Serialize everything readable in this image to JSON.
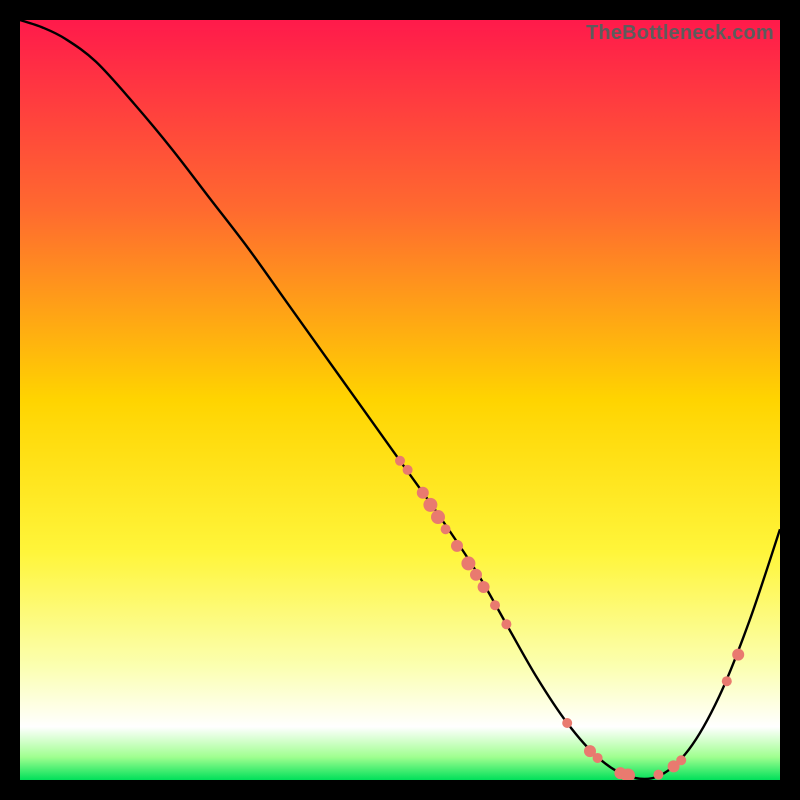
{
  "watermark": "TheBottleneck.com",
  "chart_data": {
    "type": "line",
    "title": "",
    "xlabel": "",
    "ylabel": "",
    "xlim": [
      0,
      100
    ],
    "ylim": [
      0,
      100
    ],
    "background_gradient_stops": [
      {
        "offset": 0.0,
        "color": "#ff1a4b"
      },
      {
        "offset": 0.25,
        "color": "#ff6a2f"
      },
      {
        "offset": 0.5,
        "color": "#ffd400"
      },
      {
        "offset": 0.7,
        "color": "#fff53a"
      },
      {
        "offset": 0.85,
        "color": "#fbffb0"
      },
      {
        "offset": 0.93,
        "color": "#ffffff"
      },
      {
        "offset": 0.97,
        "color": "#9fff8f"
      },
      {
        "offset": 1.0,
        "color": "#00e05a"
      }
    ],
    "series": [
      {
        "name": "bottleneck-curve",
        "x": [
          0,
          3,
          6,
          10,
          15,
          20,
          25,
          30,
          35,
          40,
          45,
          50,
          55,
          60,
          64,
          68,
          72,
          76,
          80,
          84,
          88,
          92,
          96,
          100
        ],
        "y": [
          100,
          99,
          97.5,
          94.5,
          89,
          83,
          76.5,
          70,
          63,
          56,
          49,
          42,
          35,
          27.5,
          20.5,
          13.5,
          7.5,
          3,
          0.5,
          0.5,
          4,
          11,
          21,
          33
        ]
      }
    ],
    "markers": [
      {
        "name": "pt-a",
        "x": 50,
        "y": 42,
        "r": 5
      },
      {
        "name": "pt-b",
        "x": 51,
        "y": 40.8,
        "r": 5
      },
      {
        "name": "pt-c",
        "x": 53,
        "y": 37.8,
        "r": 6
      },
      {
        "name": "pt-d",
        "x": 54,
        "y": 36.2,
        "r": 7
      },
      {
        "name": "pt-e",
        "x": 55,
        "y": 34.6,
        "r": 7
      },
      {
        "name": "pt-f",
        "x": 56,
        "y": 33.0,
        "r": 5
      },
      {
        "name": "pt-g",
        "x": 57.5,
        "y": 30.8,
        "r": 6
      },
      {
        "name": "pt-h",
        "x": 59,
        "y": 28.5,
        "r": 7
      },
      {
        "name": "pt-i",
        "x": 60,
        "y": 27.0,
        "r": 6
      },
      {
        "name": "pt-j",
        "x": 61,
        "y": 25.4,
        "r": 6
      },
      {
        "name": "pt-k",
        "x": 62.5,
        "y": 23.0,
        "r": 5
      },
      {
        "name": "pt-l",
        "x": 64,
        "y": 20.5,
        "r": 5
      },
      {
        "name": "pt-m",
        "x": 72,
        "y": 7.5,
        "r": 5
      },
      {
        "name": "pt-n",
        "x": 75,
        "y": 3.8,
        "r": 6
      },
      {
        "name": "pt-o",
        "x": 76,
        "y": 2.9,
        "r": 5
      },
      {
        "name": "pt-p",
        "x": 79,
        "y": 0.9,
        "r": 6
      },
      {
        "name": "pt-q",
        "x": 80,
        "y": 0.6,
        "r": 7
      },
      {
        "name": "pt-r",
        "x": 84,
        "y": 0.7,
        "r": 5
      },
      {
        "name": "pt-s",
        "x": 86,
        "y": 1.8,
        "r": 6
      },
      {
        "name": "pt-t",
        "x": 87,
        "y": 2.6,
        "r": 5
      },
      {
        "name": "pt-u",
        "x": 93,
        "y": 13.0,
        "r": 5
      },
      {
        "name": "pt-v",
        "x": 94.5,
        "y": 16.5,
        "r": 6
      }
    ],
    "marker_color": "#e97a6f"
  }
}
